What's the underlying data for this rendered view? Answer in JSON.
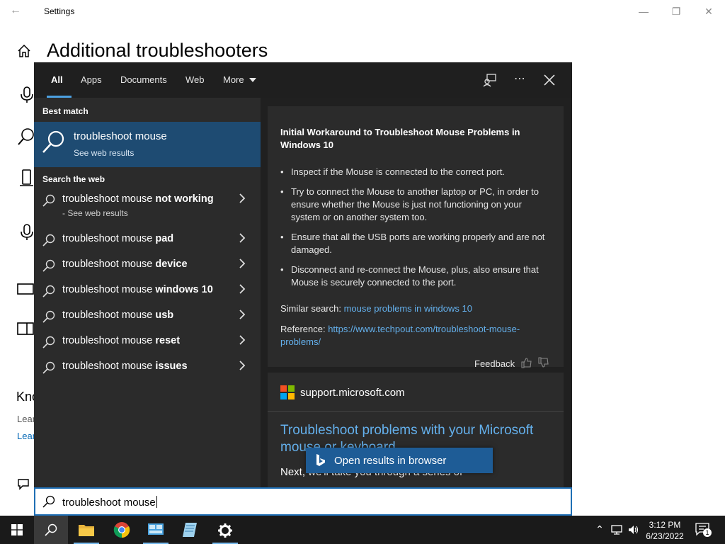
{
  "settings": {
    "window_title": "Settings",
    "page_title": "Additional troubleshooters",
    "partial_heading": "Kno",
    "partial_link1": "Lear",
    "partial_link2": "Lear"
  },
  "search": {
    "tabs": [
      {
        "label": "All"
      },
      {
        "label": "Apps"
      },
      {
        "label": "Documents"
      },
      {
        "label": "Web"
      },
      {
        "label": "More"
      }
    ],
    "best_match_heading": "Best match",
    "best_match": {
      "title": "troubleshoot mouse",
      "subtitle": "See web results"
    },
    "web_heading": "Search the web",
    "suggestions": [
      {
        "base": "troubleshoot mouse ",
        "bold": "not working",
        "sub": "- See web results"
      },
      {
        "base": "troubleshoot mouse ",
        "bold": "pad"
      },
      {
        "base": "troubleshoot mouse ",
        "bold": "device"
      },
      {
        "base": "troubleshoot mouse ",
        "bold": "windows 10"
      },
      {
        "base": "troubleshoot mouse ",
        "bold": "usb"
      },
      {
        "base": "troubleshoot mouse ",
        "bold": "reset"
      },
      {
        "base": "troubleshoot mouse ",
        "bold": "issues"
      }
    ],
    "query": "troubleshoot mouse"
  },
  "preview": {
    "title": "Initial Workaround to Troubleshoot Mouse Problems in Windows 10",
    "bullets": [
      "Inspect if the Mouse is connected to the correct port.",
      "Try to connect the Mouse to another laptop or PC, in order to ensure whether the Mouse is just not functioning on your system or on another system too.",
      "Ensure that all the USB ports are working properly and are not damaged.",
      "Disconnect and re-connect the Mouse, plus, also ensure that Mouse is securely connected to the port."
    ],
    "similar_label": "Similar search: ",
    "similar_link": "mouse problems in windows 10",
    "reference_label": "Reference: ",
    "reference_link": "https://www.techpout.com/troubleshoot-mouse-problems/",
    "feedback_label": "Feedback",
    "source_domain": "support.microsoft.com",
    "source_title": "Troubleshoot problems with your Microsoft mouse or keyboard",
    "source_body": "Next, we'll take you through a series of",
    "open_browser_label": "Open results in browser"
  },
  "taskbar": {
    "time": "3:12 PM",
    "date": "6/23/2022",
    "notification_count": "1"
  },
  "colors": {
    "accent": "#1e4b72",
    "link": "#64b0ec",
    "panel_bg": "#2b2b2b",
    "taskbar_bg": "#1a1a1a"
  }
}
